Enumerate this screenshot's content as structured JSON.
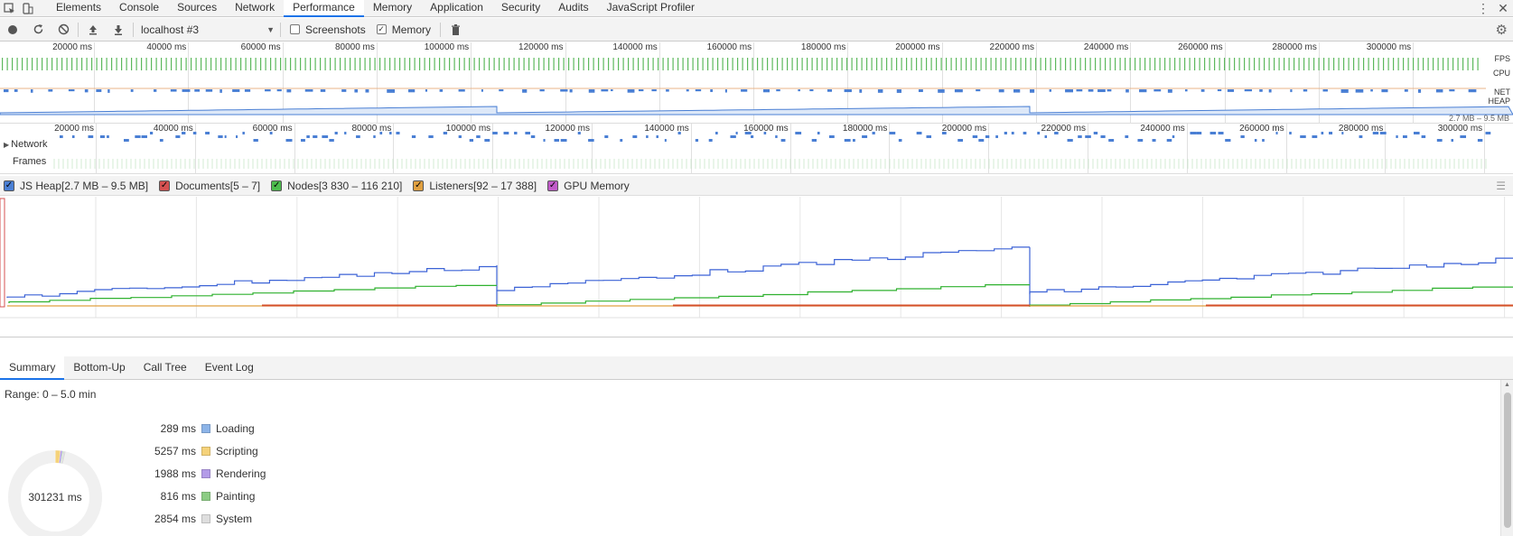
{
  "tabs": [
    "Elements",
    "Console",
    "Sources",
    "Network",
    "Performance",
    "Memory",
    "Application",
    "Security",
    "Audits",
    "JavaScript Profiler"
  ],
  "active_tab": "Performance",
  "toolbar": {
    "target": "localhost #3",
    "screenshots_label": "Screenshots",
    "screenshots_checked": false,
    "memory_label": "Memory",
    "memory_checked": true
  },
  "ruler_labels": [
    "20000 ms",
    "40000 ms",
    "60000 ms",
    "80000 ms",
    "100000 ms",
    "120000 ms",
    "140000 ms",
    "160000 ms",
    "180000 ms",
    "200000 ms",
    "220000 ms",
    "240000 ms",
    "260000 ms",
    "280000 ms",
    "300000 ms"
  ],
  "overview_tracks": {
    "fps": "FPS",
    "cpu": "CPU",
    "net": "NET",
    "heap": "HEAP",
    "heap_range": "2.7 MB – 9.5 MB"
  },
  "flame_rows": {
    "network": "Network",
    "frames": "Frames"
  },
  "counters": [
    {
      "label": "JS Heap[2.7 MB – 9.5 MB]",
      "color": "#4a7fd4",
      "checked": true
    },
    {
      "label": "Documents[5 – 7]",
      "color": "#d45050",
      "checked": true
    },
    {
      "label": "Nodes[3 830 – 116 210]",
      "color": "#4cbc4c",
      "checked": true
    },
    {
      "label": "Listeners[92 – 17 388]",
      "color": "#e0a040",
      "checked": true
    },
    {
      "label": "GPU Memory",
      "color": "#c05ac8",
      "checked": true
    }
  ],
  "bottom_tabs": [
    "Summary",
    "Bottom-Up",
    "Call Tree",
    "Event Log"
  ],
  "active_bottom_tab": "Summary",
  "summary": {
    "range": "Range: 0 – 5.0 min",
    "total": "301231 ms",
    "categories": [
      {
        "ms": "289 ms",
        "label": "Loading",
        "color": "#8cb4e8"
      },
      {
        "ms": "5257 ms",
        "label": "Scripting",
        "color": "#f5d27a"
      },
      {
        "ms": "1988 ms",
        "label": "Rendering",
        "color": "#b39be8"
      },
      {
        "ms": "816 ms",
        "label": "Painting",
        "color": "#8ccc84"
      },
      {
        "ms": "2854 ms",
        "label": "System",
        "color": "#dedede"
      }
    ],
    "donut_values": [
      289,
      5257,
      1988,
      816,
      2854,
      290027
    ]
  }
}
